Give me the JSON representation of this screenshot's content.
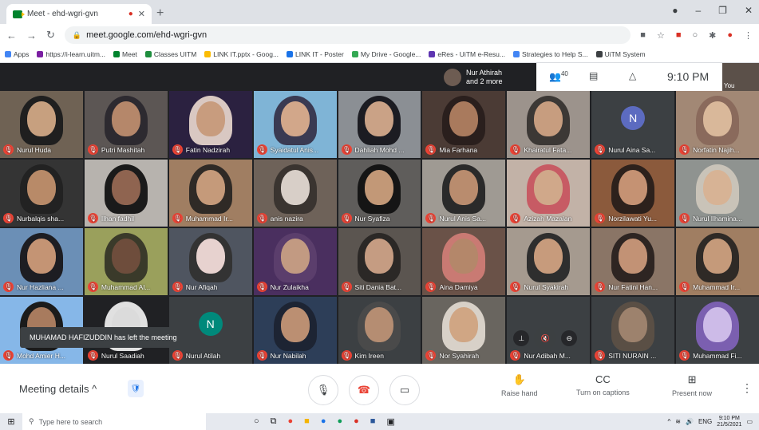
{
  "browser": {
    "tab_title": "Meet - ehd-wgri-gvn",
    "url": "meet.google.com/ehd-wgri-gvn",
    "bookmarks": [
      {
        "label": "Apps",
        "color": "#4285f4"
      },
      {
        "label": "https://i-learn.uitm...",
        "color": "#7b1fa2"
      },
      {
        "label": "Meet",
        "color": "#00832d"
      },
      {
        "label": "Classes UITM",
        "color": "#1e8e3e"
      },
      {
        "label": "LINK IT.pptx - Goog...",
        "color": "#fbbc04"
      },
      {
        "label": "LINK IT - Poster",
        "color": "#1a73e8"
      },
      {
        "label": "My Drive - Google...",
        "color": "#34a853"
      },
      {
        "label": "eRes - UiTM e-Resu...",
        "color": "#5e35b1"
      },
      {
        "label": "Strategies to Help S...",
        "color": "#4285f4"
      },
      {
        "label": "UiTM System",
        "color": "#3c4043"
      }
    ]
  },
  "meet": {
    "presenter_line1": "Nur Athirah",
    "presenter_line2": "and 2 more",
    "participant_count": "40",
    "time": "9:10 PM",
    "self_label": "You",
    "toast": "MUHAMAD HAFIZUDDIN has left the meeting",
    "meeting_details": "Meeting details",
    "raise_hand": "Raise hand",
    "captions": "Turn on captions",
    "present": "Present now"
  },
  "participants": [
    {
      "name": "Nurul Huda",
      "bg": "#6f6254",
      "skin": "#c7a07f",
      "hijab": "#1f1f1f"
    },
    {
      "name": "Putri Mashitah",
      "bg": "#5c5654",
      "skin": "#b5876a",
      "hijab": "#2d2a30"
    },
    {
      "name": "Fatin Nadzirah",
      "bg": "#2b2140",
      "skin": "#c89c7e",
      "hijab": "#d9c8c2"
    },
    {
      "name": "Syaidatul Anis...",
      "bg": "#7fb4d6",
      "skin": "#d2a78a",
      "hijab": "#3a3a52"
    },
    {
      "name": "Dahliah Mohd ...",
      "bg": "#8b8f94",
      "skin": "#caa286",
      "hijab": "#1c1c22"
    },
    {
      "name": "Mia Farhana",
      "bg": "#4b3b35",
      "skin": "#a97a5d",
      "hijab": "#2a1f1d"
    },
    {
      "name": "Khairatul Fata...",
      "bg": "#9c938c",
      "skin": "#c79d7f",
      "hijab": "#3c3835"
    },
    {
      "name": "Nurul Aina Sa...",
      "bg": "#3c4043",
      "initial": "N",
      "initial_bg": "#5c6bc0"
    },
    {
      "name": "Norfatin Najih...",
      "bg": "#a28875",
      "skin": "#d9b89a",
      "hijab": "#8a6a5c"
    },
    {
      "name": "Nurbalqis sha...",
      "bg": "#343434",
      "skin": "#b88a68",
      "hijab": "#222"
    },
    {
      "name": "Ilhan fadhil",
      "bg": "#b7b3ae",
      "skin": "#8f6450",
      "hijab": "#1a1a1a"
    },
    {
      "name": "Muhammad Ir...",
      "bg": "#a07e62",
      "skin": "#c59a7a",
      "hijab": "#2f2a26"
    },
    {
      "name": "anis nazira",
      "bg": "#6e6259",
      "skin": "#d8cfc8",
      "hijab": "#3a3430"
    },
    {
      "name": "Nur Syafiza",
      "bg": "#5f5d5b",
      "skin": "#c29877",
      "hijab": "#151515"
    },
    {
      "name": "Nurul Anis Sa...",
      "bg": "#9f9a93",
      "skin": "#b98c6e",
      "hijab": "#2a2a2a"
    },
    {
      "name": "Azizah Mazalan",
      "bg": "#c2b2a7",
      "skin": "#d0a88a",
      "hijab": "#c75b64"
    },
    {
      "name": "Norzilawati Yu...",
      "bg": "#8b5a3c",
      "skin": "#c59273",
      "hijab": "#2d211c"
    },
    {
      "name": "Nurul Ilhamina...",
      "bg": "#8f9390",
      "skin": "#d7b395",
      "hijab": "#c9c3b8"
    },
    {
      "name": "Nur Hazliana ...",
      "bg": "#6b8fb6",
      "skin": "#c49474",
      "hijab": "#1d1d22"
    },
    {
      "name": "Muhammad Al...",
      "bg": "#9aa05c",
      "skin": "#6e4d3c",
      "hijab": "#3a3a2a"
    },
    {
      "name": "Nur Afiqah",
      "bg": "#4f5560",
      "skin": "#e7d2cf",
      "hijab": "#333"
    },
    {
      "name": "Nur Zulaikha",
      "bg": "#4a2f5f",
      "skin": "#c29a82",
      "hijab": "#5b3e6c"
    },
    {
      "name": "Siti Dania Bat...",
      "bg": "#5b5550",
      "skin": "#c59c82",
      "hijab": "#2b2826"
    },
    {
      "name": "Aina Damiya",
      "bg": "#6a5248",
      "skin": "#b4876a",
      "hijab": "#c97a73"
    },
    {
      "name": "Nurul Syakirah",
      "bg": "#a59a8f",
      "skin": "#c79b7c",
      "hijab": "#2e2e2e"
    },
    {
      "name": "Nur Fatini Han...",
      "bg": "#8a7566",
      "skin": "#c29275",
      "hijab": "#2e2522"
    },
    {
      "name": "Muhammad Ir...",
      "bg": "#a07e62",
      "skin": "#c59a7a",
      "hijab": "#2f2a26"
    },
    {
      "name": "Mohd Amier H...",
      "bg": "#86b7e8",
      "skin": "#a87b5e",
      "hijab": "#1b1b1b"
    },
    {
      "name": "Nurul Saadiah",
      "bg": "#202124",
      "skin": "#dbdbdb",
      "hijab": "#e0e0e0"
    },
    {
      "name": "Nurul Atilah",
      "bg": "#3c4043",
      "initial": "N",
      "initial_bg": "#00897b"
    },
    {
      "name": "Nur Nabilah",
      "bg": "#2d3e58",
      "skin": "#bb8f72",
      "hijab": "#1d2433"
    },
    {
      "name": "Kim Ireen",
      "bg": "#3c4043",
      "skin": "#b58d72",
      "hijab": "#4a4a4a"
    },
    {
      "name": "Nor Syahirah",
      "bg": "#69655f",
      "skin": "#d0a684",
      "hijab": "#d8d1c8"
    },
    {
      "name": "Nur Adibah M...",
      "bg": "#3c4043",
      "hover": true
    },
    {
      "name": "SITI NURAIN ...",
      "bg": "#3c4043",
      "skin": "#9d826d",
      "hijab": "#5a4f45"
    },
    {
      "name": "Muhammad Fi...",
      "bg": "#3c4043",
      "skin": "#cdbbe8",
      "hijab": "#7b5fb0"
    }
  ],
  "taskbar": {
    "search_placeholder": "Type here to search",
    "lang": "ENG",
    "time": "9:10 PM",
    "date": "21/5/2021"
  }
}
